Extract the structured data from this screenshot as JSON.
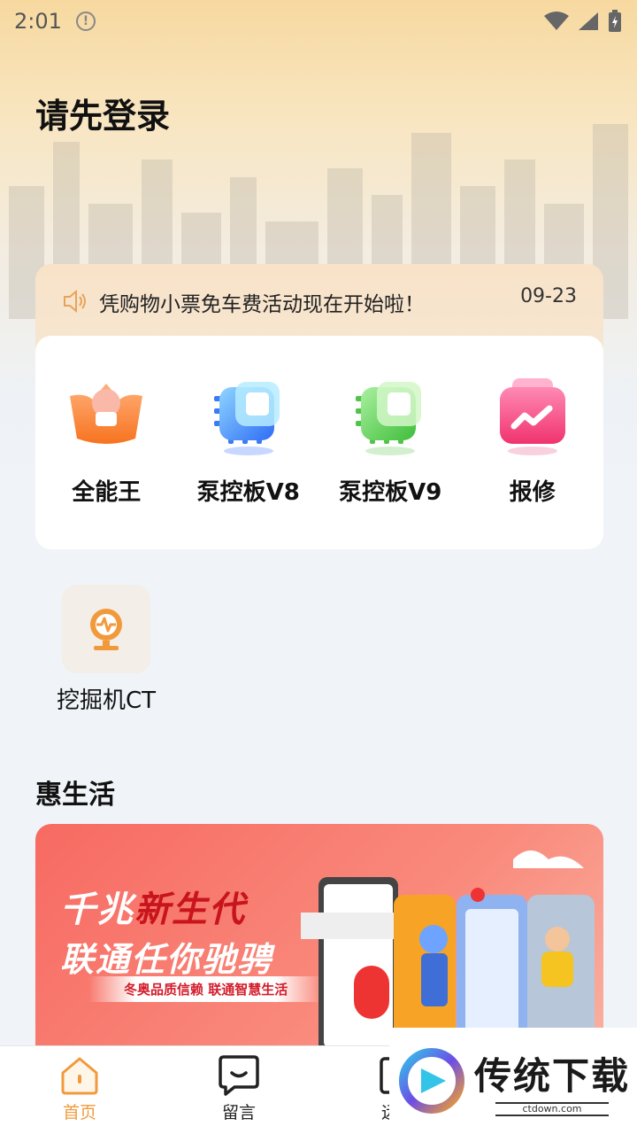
{
  "status": {
    "time": "2:01"
  },
  "header": {
    "title": "请先登录"
  },
  "notice": {
    "text": "凭购物小票免车费活动现在开始啦！",
    "date": "09-23"
  },
  "apps": [
    {
      "label": "全能王",
      "icon": "all-in-one-icon"
    },
    {
      "label": "泵控板V8",
      "icon": "pump-board-v8-icon"
    },
    {
      "label": "泵控板V9",
      "icon": "pump-board-v9-icon"
    },
    {
      "label": "报修",
      "icon": "repair-icon"
    }
  ],
  "extra_app": {
    "label": "挖掘机CT",
    "icon": "excavator-ct-icon"
  },
  "section": {
    "title": "惠生活"
  },
  "banner": {
    "line1_part1": "千兆",
    "line1_part2": "新生代",
    "line2": "联通任你驰骋",
    "sub": "冬奥品质信赖  联通智慧生活"
  },
  "tabbar": {
    "home": "首页",
    "messages": "留言",
    "remote": "远程"
  },
  "watermark": {
    "title": "传统下载",
    "url": "ctdown.com"
  },
  "colors": {
    "accent": "#f29a3b",
    "banner": "#f76a62"
  }
}
